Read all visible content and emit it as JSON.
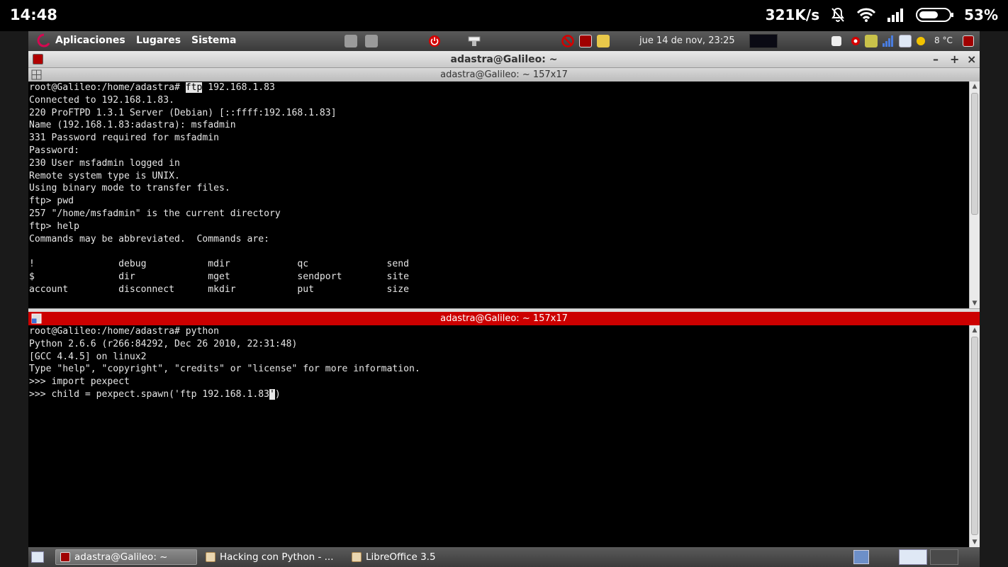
{
  "android": {
    "time": "14:48",
    "net_speed": "321K/s",
    "battery": "53%"
  },
  "panel": {
    "menu": [
      "Aplicaciones",
      "Lugares",
      "Sistema"
    ],
    "datetime": "jue 14 de nov, 23:25",
    "temperature": "8 °C"
  },
  "window": {
    "title": "adastra@Galileo: ~",
    "minimize": "–",
    "maximize": "+",
    "close": "×"
  },
  "pane1": {
    "title": "adastra@Galileo: ~ 157x17",
    "prompt_prefix": "root@Galileo:/home/adastra# ",
    "prompt_highlight": "ftp",
    "prompt_suffix": " 192.168.1.83",
    "lines": [
      "Connected to 192.168.1.83.",
      "220 ProFTPD 1.3.1 Server (Debian) [::ffff:192.168.1.83]",
      "Name (192.168.1.83:adastra): msfadmin",
      "331 Password required for msfadmin",
      "Password:",
      "230 User msfadmin logged in",
      "Remote system type is UNIX.",
      "Using binary mode to transfer files.",
      "ftp> pwd",
      "257 \"/home/msfadmin\" is the current directory",
      "ftp> help",
      "Commands may be abbreviated.  Commands are:",
      "",
      "!               debug           mdir            qc              send",
      "$               dir             mget            sendport        site",
      "account         disconnect      mkdir           put             size"
    ]
  },
  "pane2": {
    "title": "adastra@Galileo: ~ 157x17",
    "lines": [
      "root@Galileo:/home/adastra# python",
      "Python 2.6.6 (r266:84292, Dec 26 2010, 22:31:48)",
      "[GCC 4.4.5] on linux2",
      "Type \"help\", \"copyright\", \"credits\" or \"license\" for more information.",
      ">>> import pexpect"
    ],
    "last_before_cursor": ">>> child = pexpect.spawn('ftp 192.168.1.83",
    "cursor_char": "'",
    "last_after_cursor": ")"
  },
  "taskbar": {
    "tasks": [
      "adastra@Galileo: ~",
      "Hacking con Python - ...",
      "LibreOffice 3.5"
    ]
  },
  "colors": {
    "active_pane_header": "#cc0000",
    "terminal_bg": "#000000",
    "terminal_fg": "#e6e6e6"
  }
}
